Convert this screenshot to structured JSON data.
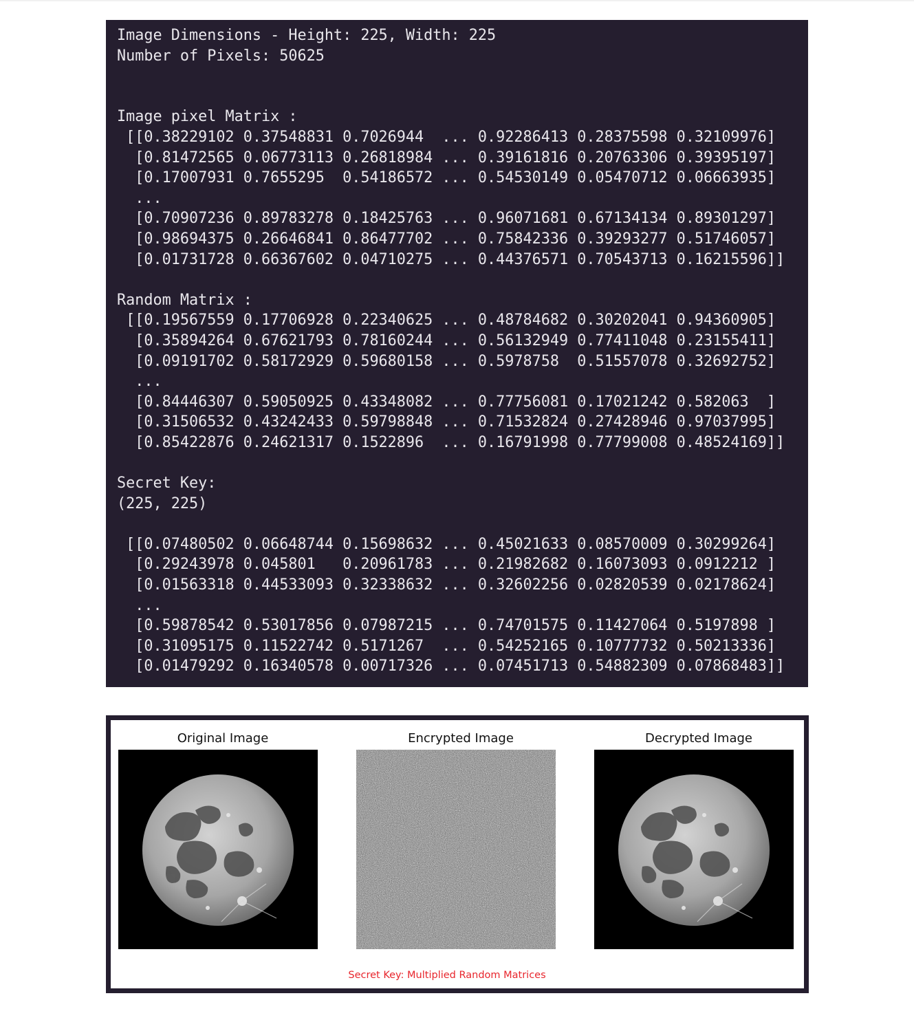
{
  "console": {
    "dimensions_line": "Image Dimensions - Height: 225, Width: 225",
    "pixels_line": "Number of Pixels: 50625",
    "image_matrix": {
      "title": "Image pixel Matrix :",
      "rows": [
        " [[0.38229102 0.37548831 0.7026944  ... 0.92286413 0.28375598 0.32109976]",
        "  [0.81472565 0.06773113 0.26818984 ... 0.39161816 0.20763306 0.39395197]",
        "  [0.17007931 0.7655295  0.54186572 ... 0.54530149 0.05470712 0.06663935]",
        "  ...",
        "  [0.70907236 0.89783278 0.18425763 ... 0.96071681 0.67134134 0.89301297]",
        "  [0.98694375 0.26646841 0.86477702 ... 0.75842336 0.39293277 0.51746057]",
        "  [0.01731728 0.66367602 0.04710275 ... 0.44376571 0.70543713 0.16215596]]"
      ]
    },
    "random_matrix": {
      "title": "Random Matrix :",
      "rows": [
        " [[0.19567559 0.17706928 0.22340625 ... 0.48784682 0.30202041 0.94360905]",
        "  [0.35894264 0.67621793 0.78160244 ... 0.56132949 0.77411048 0.23155411]",
        "  [0.09191702 0.58172929 0.59680158 ... 0.5978758  0.51557078 0.32692752]",
        "  ...",
        "  [0.84446307 0.59050925 0.43348082 ... 0.77756081 0.17021242 0.582063  ]",
        "  [0.31506532 0.43242433 0.59798848 ... 0.71532824 0.27428946 0.97037995]",
        "  [0.85422876 0.24621317 0.1522896  ... 0.16791998 0.77799008 0.48524169]]"
      ]
    },
    "secret_key": {
      "title": "Secret Key:",
      "shape": "(225, 225)",
      "rows": [
        " [[0.07480502 0.06648744 0.15698632 ... 0.45021633 0.08570009 0.30299264]",
        "  [0.29243978 0.045801   0.20961783 ... 0.21982682 0.16073093 0.0912212 ]",
        "  [0.01563318 0.44533093 0.32338632 ... 0.32602256 0.02820539 0.02178624]",
        "  ...",
        "  [0.59878542 0.53017856 0.07987215 ... 0.74701575 0.11427064 0.5197898 ]",
        "  [0.31095175 0.11522742 0.5171267  ... 0.54252165 0.10777732 0.50213336]",
        "  [0.01479292 0.16340578 0.00717326 ... 0.07451713 0.54882309 0.07868483]]"
      ]
    }
  },
  "figure": {
    "panels": [
      {
        "title": "Original Image",
        "image": "moon-image"
      },
      {
        "title": "Encrypted Image",
        "image": "noise-image"
      },
      {
        "title": "Decrypted Image",
        "image": "moon-image"
      }
    ],
    "caption": "Secret Key: Multiplied Random Matrices",
    "caption_color": "#e8252c"
  },
  "colors": {
    "console_background": "#251e2f",
    "console_text": "#e9e7ec",
    "figure_background": "#ffffff"
  }
}
